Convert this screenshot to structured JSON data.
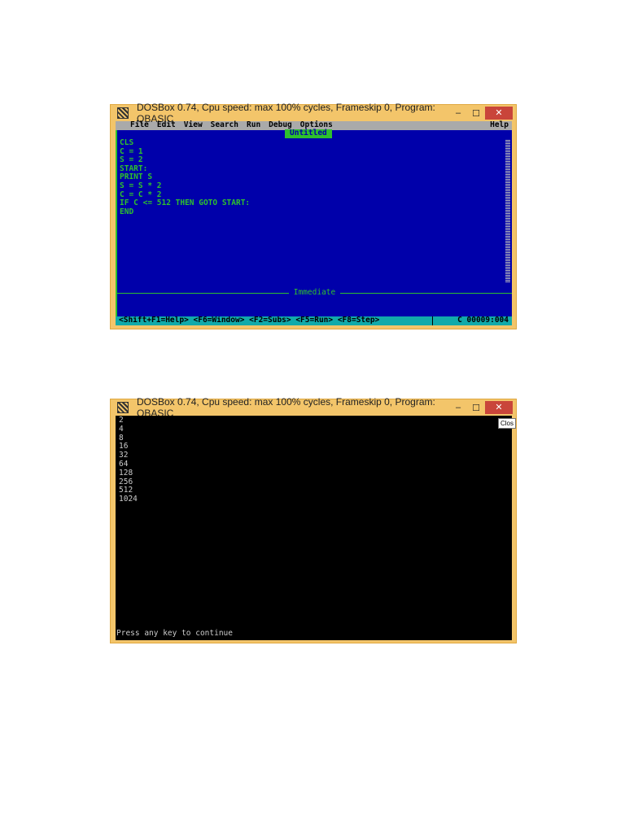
{
  "window1": {
    "title": "DOSBox 0.74, Cpu speed: max 100% cycles, Frameskip  0, Program:  QBASIC",
    "menu": [
      "File",
      "Edit",
      "View",
      "Search",
      "Run",
      "Debug",
      "Options"
    ],
    "help": "Help",
    "editor_title": "Untitled",
    "code": "CLS\nC = 1\nS = 2\nSTART:\nPRINT S\nS = S * 2\nC = C * 2\nIF C <= 512 THEN GOTO START:\nEND",
    "immediate": "Immediate",
    "status": "<Shift+F1=Help> <F6=Window> <F2=Subs> <F5=Run> <F8=Step>",
    "position": "C  00009:004"
  },
  "window2": {
    "title": "DOSBox 0.74, Cpu speed: max 100% cycles, Frameskip  0, Program:  QBASIC",
    "output": "2\n4\n8\n16\n32\n64\n128\n256\n512\n1024",
    "prompt": "Press any key to continue",
    "tooltip": "Clos"
  },
  "controls": {
    "minimize": "–",
    "maximize": "☐",
    "close": "✕"
  }
}
